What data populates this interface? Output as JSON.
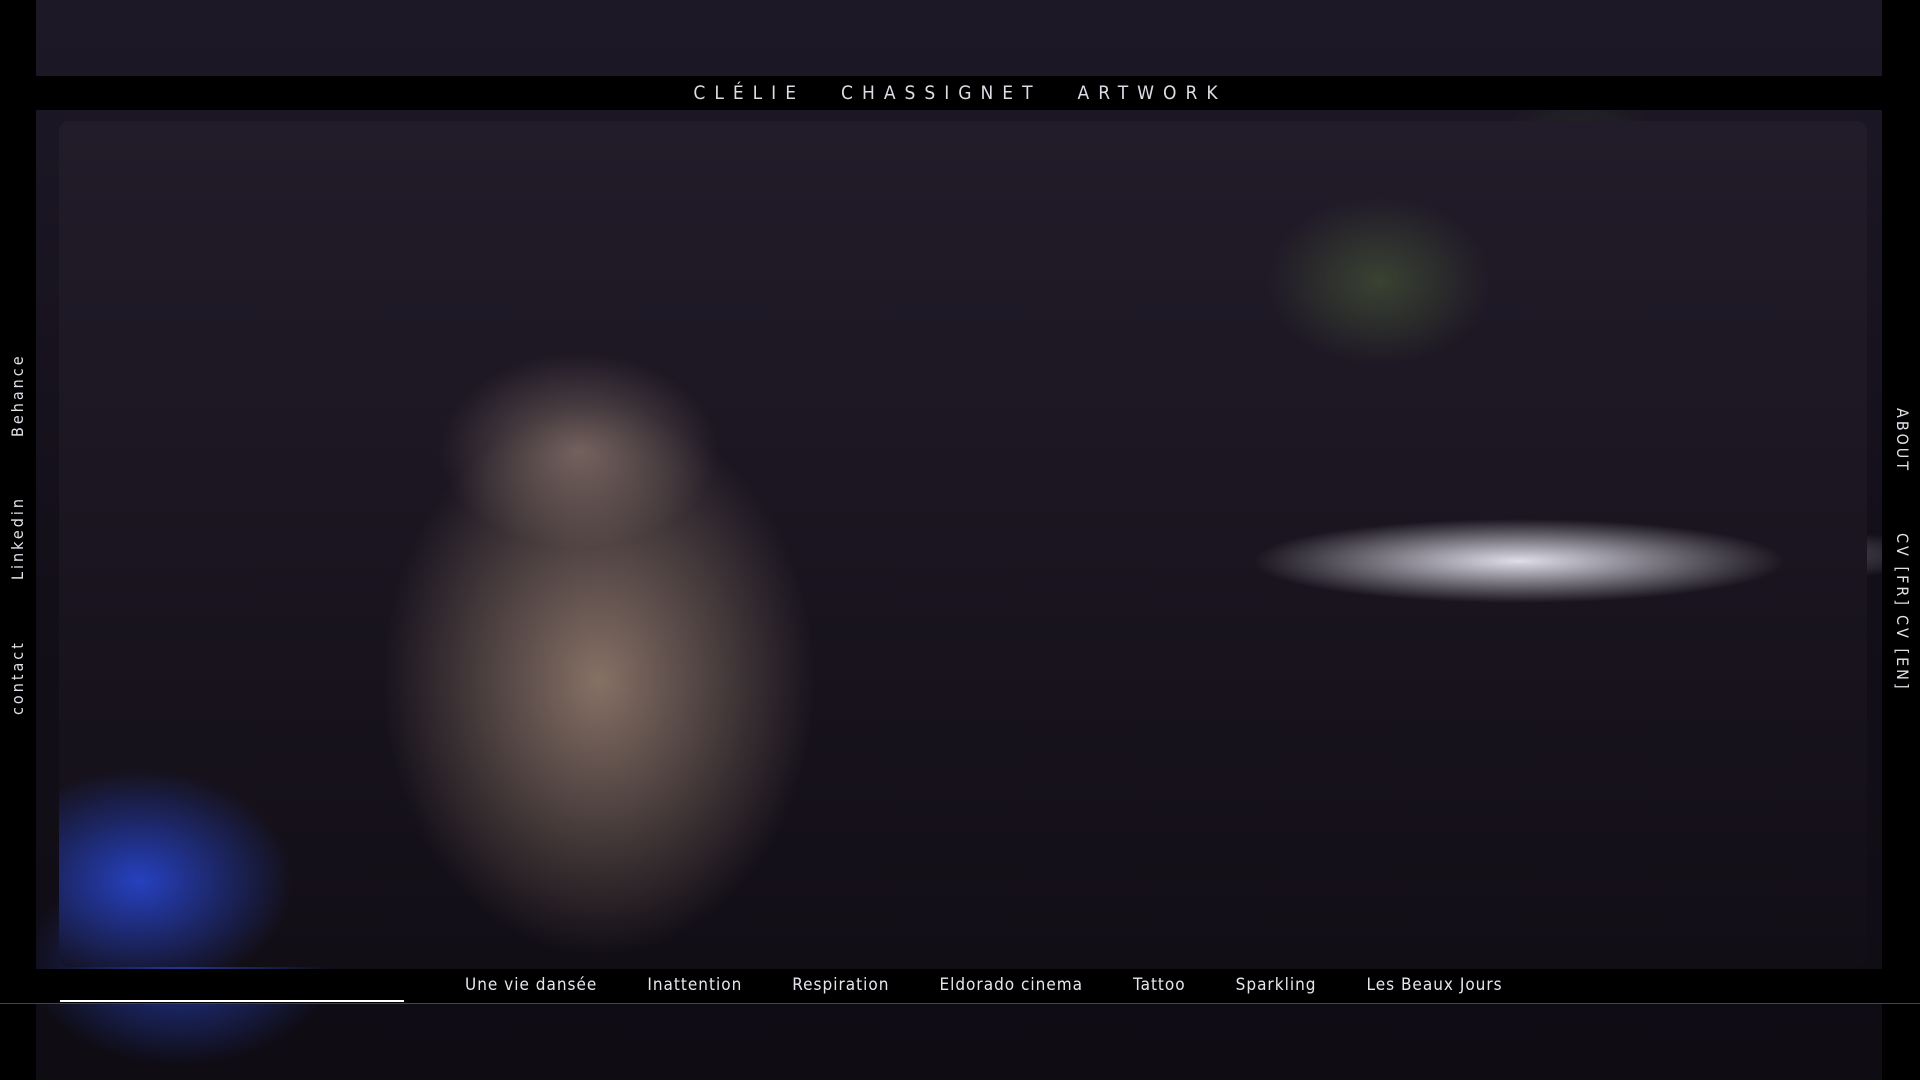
{
  "header": {
    "words": [
      "CLÉLIE",
      "CHASSIGNET",
      "ARTWORK"
    ]
  },
  "left_links": [
    "Behance",
    "Linkedin",
    "contact"
  ],
  "right_links": [
    "ABOUT",
    "CV [FR]",
    "CV [EN]"
  ],
  "projects": [
    "Une vie dansée",
    "Inattention",
    "Respiration",
    "Eldorado cinema",
    "Tattoo",
    "Sparkling",
    "Les Beaux Jours"
  ],
  "progress_fraction": 0.19
}
